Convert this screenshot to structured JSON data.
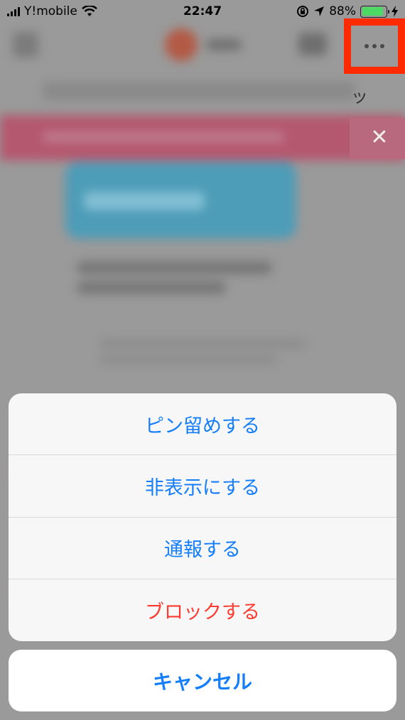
{
  "status_bar": {
    "carrier": "Y!mobile",
    "time": "22:47",
    "battery_percent": "88%",
    "battery_level": 0.88,
    "icons": [
      "signal-icon",
      "wifi-icon",
      "orientation-lock-icon",
      "location-icon",
      "battery-icon",
      "charging-icon"
    ]
  },
  "background_app": {
    "tab_partial_text": "ッ",
    "close_icon": "close-icon",
    "more_button_icon": "more-horizontal-icon",
    "highlight_color": "#ff2a00",
    "banner_color": "#b4586f"
  },
  "action_sheet": {
    "items": [
      {
        "label": "ピン留めする",
        "style": "default"
      },
      {
        "label": "非表示にする",
        "style": "default"
      },
      {
        "label": "通報する",
        "style": "default"
      },
      {
        "label": "ブロックする",
        "style": "destructive"
      }
    ],
    "cancel_label": "キャンセル",
    "accent_color": "#157efb",
    "destructive_color": "#fe3b30"
  }
}
